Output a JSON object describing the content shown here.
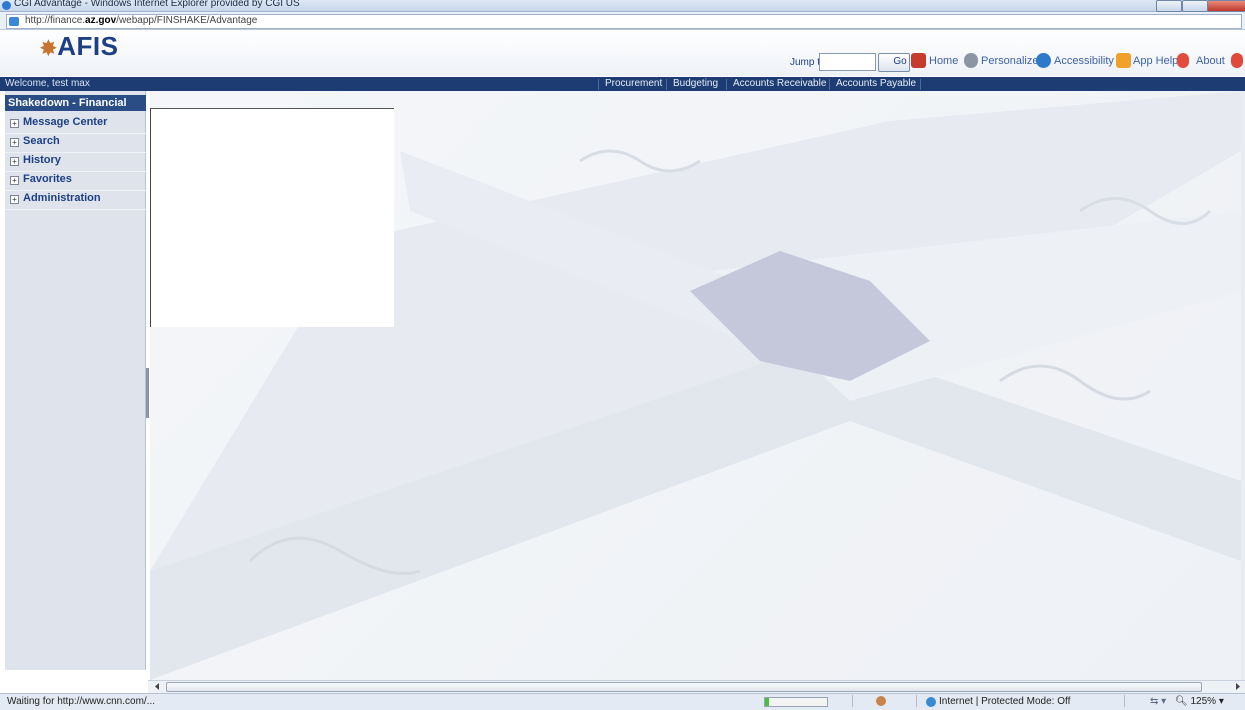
{
  "browser": {
    "title": "CGI Advantage - Windows Internet Explorer provided by CGI US",
    "url_prefix": "http://finance.",
    "url_domain": "az.gov",
    "url_path": "/webapp/FINSHAKE/Advantage"
  },
  "header": {
    "logo": "AFIS",
    "jump_label": "Jump to:",
    "jump_value": "",
    "go_label": "Go",
    "links": [
      "Home",
      "Personalize",
      "Accessibility",
      "App Help",
      "About"
    ]
  },
  "navbar": {
    "welcome": "Welcome, test max",
    "tabs": [
      "Procurement",
      "Budgeting",
      "Accounts Receivable",
      "Accounts Payable"
    ]
  },
  "sidebar": {
    "heading": "Shakedown - Financial",
    "items": [
      "Message Center",
      "Search",
      "History",
      "Favorites",
      "Administration"
    ]
  },
  "status": {
    "text": "Waiting for http://www.cnn.com/...",
    "progress": 0.07,
    "zone": "Internet | Protected Mode: Off",
    "zoom": "125%"
  },
  "colors": {
    "navbar": "#1c3c73",
    "accent": "#1e3f86",
    "sidebar": "#dfe4ec"
  }
}
